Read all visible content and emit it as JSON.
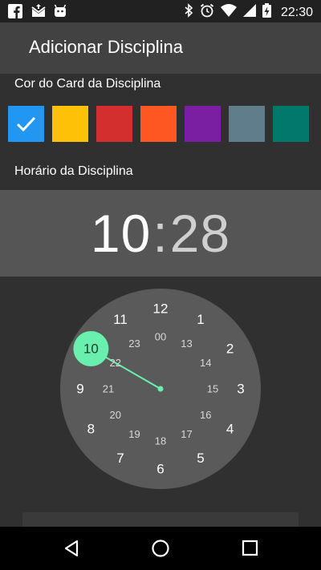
{
  "status_bar": {
    "time": "22:30",
    "left_icons": [
      "facebook-icon",
      "mail-icon",
      "android-icon"
    ],
    "right_icons": [
      "bluetooth-icon",
      "alarm-icon",
      "wifi-icon",
      "signal-icon",
      "battery-charging-icon"
    ]
  },
  "app_bar": {
    "title": "Adicionar Disciplina"
  },
  "color_section": {
    "label": "Cor do Card da Disciplina",
    "swatches": [
      "#2196F3",
      "#FFC107",
      "#D32F2F",
      "#FF5722",
      "#7B1FA2",
      "#607D8B",
      "#00796B"
    ],
    "selected_index": 0
  },
  "time_section": {
    "label": "Horário da Disciplina",
    "hour": "10",
    "separator": ":",
    "minute": "28"
  },
  "clock": {
    "selected_hour": "10",
    "outer_hours": [
      "12",
      "1",
      "2",
      "3",
      "4",
      "5",
      "6",
      "7",
      "8",
      "9",
      "10",
      "11"
    ],
    "inner_hours": [
      "00",
      "13",
      "14",
      "15",
      "16",
      "17",
      "18",
      "19",
      "20",
      "21",
      "22",
      "23"
    ],
    "accent_color": "#69F0AE",
    "face_color": "#5a5a5a"
  },
  "nav_bar": {
    "icons": [
      "back-icon",
      "home-icon",
      "recents-icon"
    ]
  }
}
